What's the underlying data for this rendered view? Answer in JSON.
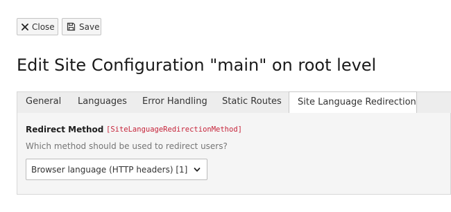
{
  "toolbar": {
    "close_label": "Close",
    "save_label": "Save"
  },
  "page": {
    "title": "Edit Site Configuration \"main\" on root level"
  },
  "tabs": [
    {
      "label": "General"
    },
    {
      "label": "Languages"
    },
    {
      "label": "Error Handling"
    },
    {
      "label": "Static Routes"
    },
    {
      "label": "Site Language Redirection",
      "active": true
    }
  ],
  "field": {
    "label": "Redirect Method",
    "key": "[SiteLanguageRedirectionMethod]",
    "description": "Which method should be used to redirect users?",
    "selected_value": "Browser language (HTTP headers) [1]"
  },
  "colors": {
    "field_key": "#c6243a",
    "panel_bg": "#f5f5f5",
    "tab_bar_bg": "#ededed"
  },
  "icons": {
    "close": "close-icon",
    "save": "floppy-disk-icon",
    "select": "chevron-down-icon"
  }
}
